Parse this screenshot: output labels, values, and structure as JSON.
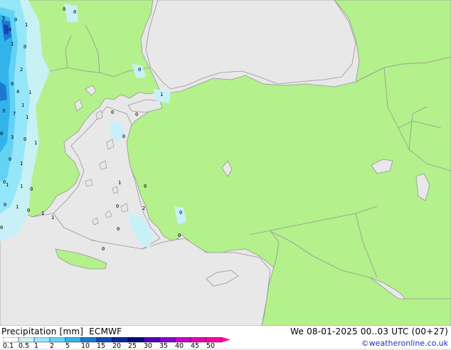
{
  "header": {
    "title": "Precipitation [mm]",
    "model": "ECMWF",
    "datetime": "We 08-01-2025 00..03 UTC (00+27)",
    "credit": "©weatheronline.co.uk"
  },
  "legend": {
    "labels": [
      "0.1",
      "0.5",
      "1",
      "2",
      "5",
      "10",
      "15",
      "20",
      "25",
      "30",
      "35",
      "40",
      "45",
      "50"
    ],
    "colors": [
      "#ffffff",
      "#c8f0f8",
      "#96e6fa",
      "#64d2f5",
      "#32b4eb",
      "#1e78d2",
      "#1446b4",
      "#0a2896",
      "#000a78",
      "#5000b4",
      "#8c00d2",
      "#c800c8",
      "#e600b4",
      "#ff00a0"
    ]
  },
  "colors": {
    "land": "#b4f08c",
    "sea": "#e8e8e8",
    "border": "#969696",
    "precip_light": "#c8f0f8",
    "precip_mid": "#96e6fa",
    "precip_strong": "#1e78d2"
  },
  "map": {
    "values": [
      "0",
      "0",
      "5",
      "4",
      "1",
      "0",
      "1",
      "0",
      "2",
      "1",
      "4",
      "0",
      "1",
      "3",
      "7",
      "1",
      "0",
      "3",
      "0",
      "1",
      "0",
      "1",
      "0",
      "1",
      "1",
      "0",
      "0",
      "1",
      "1",
      "1",
      "0",
      "0",
      "0",
      "1",
      "0",
      "0",
      "0",
      "0",
      "2",
      "0",
      "0",
      "1",
      "0",
      "0",
      "0"
    ]
  }
}
